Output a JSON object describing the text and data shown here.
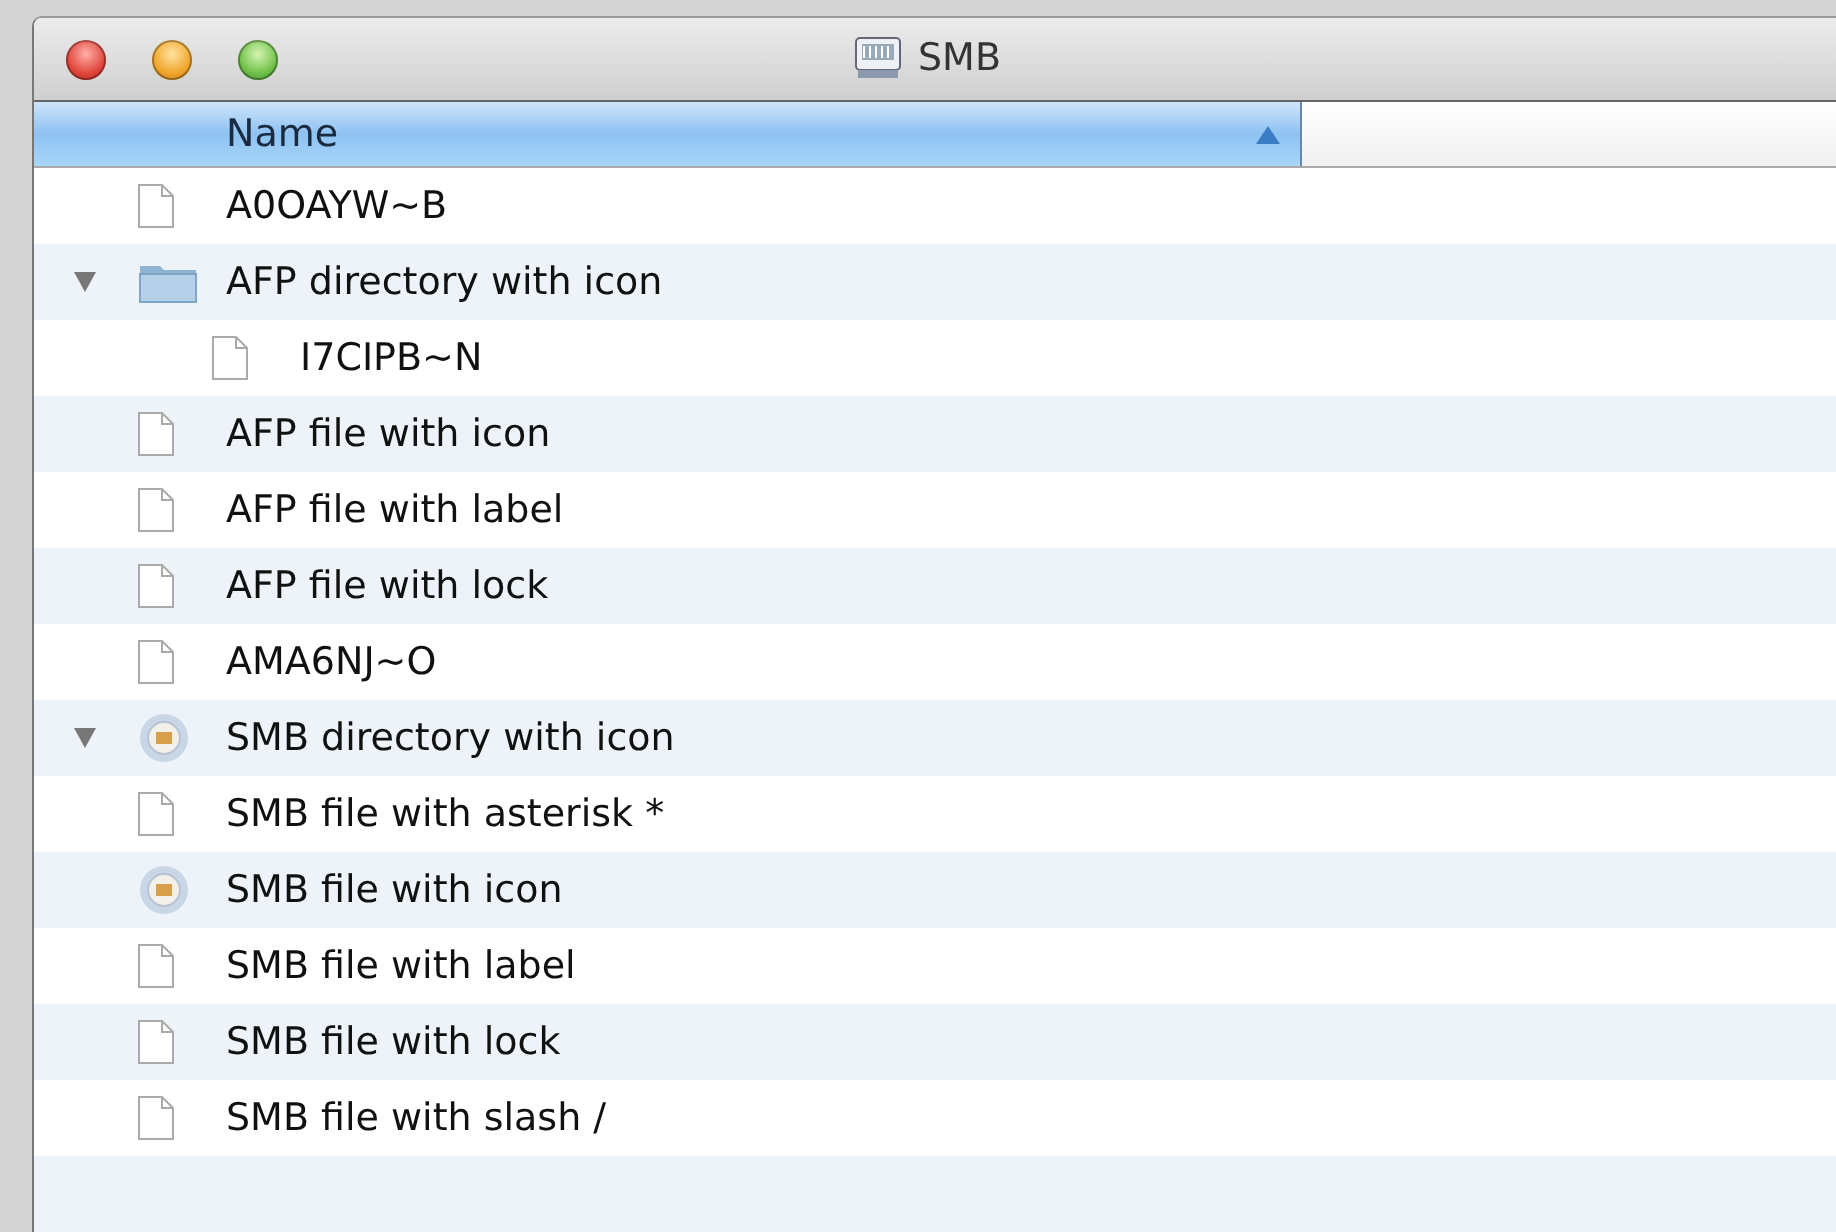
{
  "window": {
    "title": "SMB"
  },
  "columns": [
    {
      "label": "Name",
      "selected": true,
      "sort_ascending": true
    }
  ],
  "rows": [
    {
      "name": "A0OAYW~B",
      "kind": "file"
    },
    {
      "name": "AFP directory with icon",
      "kind": "folder",
      "expanded": true,
      "children": [
        {
          "name": "I7CIPB~N",
          "kind": "file"
        }
      ]
    },
    {
      "name": "AFP file with icon",
      "kind": "file"
    },
    {
      "name": "AFP file with label",
      "kind": "file"
    },
    {
      "name": "AFP file with lock",
      "kind": "file"
    },
    {
      "name": "AMA6NJ~O",
      "kind": "file"
    },
    {
      "name": "SMB directory with icon",
      "kind": "badge",
      "expanded": true
    },
    {
      "name": "SMB file with asterisk *",
      "kind": "file"
    },
    {
      "name": "SMB file with icon",
      "kind": "badge"
    },
    {
      "name": "SMB file with label",
      "kind": "file"
    },
    {
      "name": "SMB file with lock",
      "kind": "file"
    },
    {
      "name": "SMB file with slash /",
      "kind": "file"
    }
  ]
}
